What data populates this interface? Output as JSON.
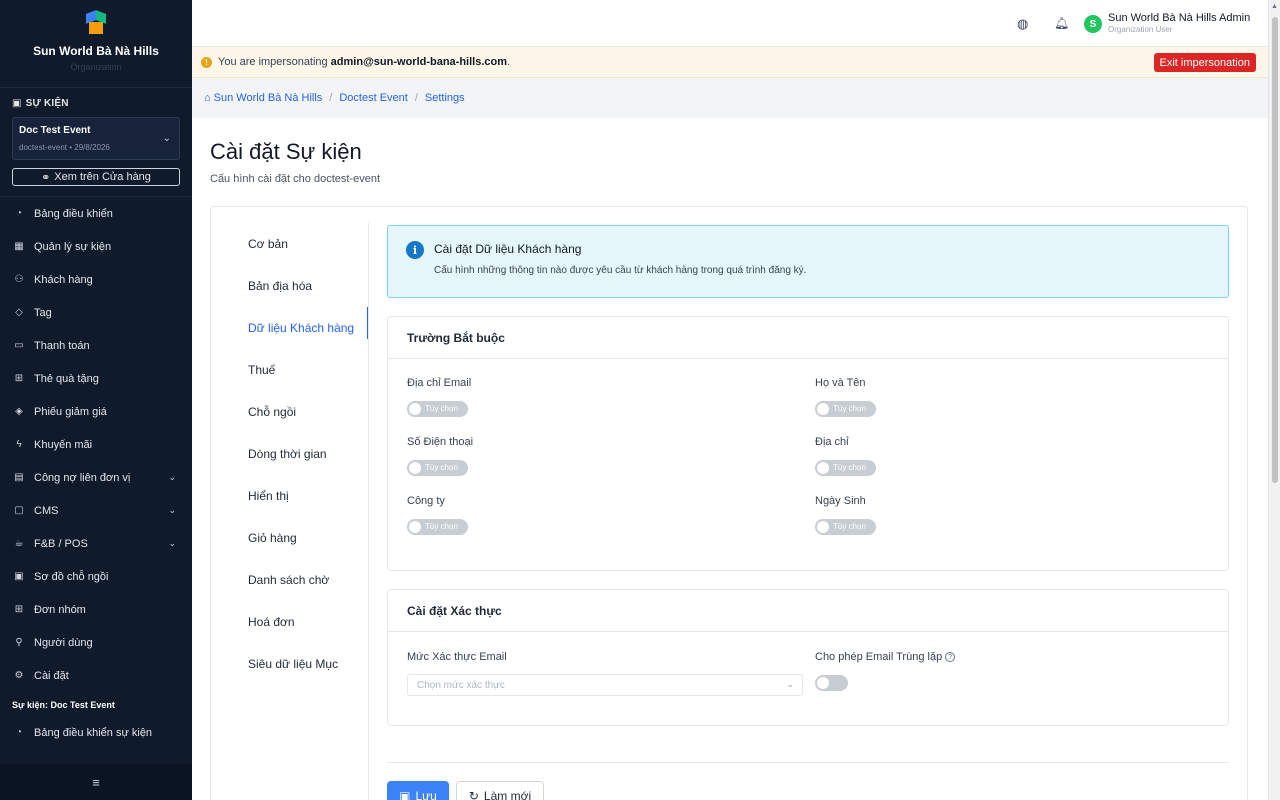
{
  "sidebar": {
    "brand_name": "Sun World Bà Nà Hills",
    "brand_sub": "Organization",
    "section_title": "SỰ KIỆN",
    "event_name": "Doc Test Event",
    "event_meta": "doctest-event • 29/8/2026",
    "store_button": "Xem trên Cửa hàng",
    "items": [
      {
        "label": "Bảng điều khiển",
        "icon": "dashboard-icon"
      },
      {
        "label": "Quản lý sự kiện",
        "icon": "calendar-icon"
      },
      {
        "label": "Khách hàng",
        "icon": "users-icon"
      },
      {
        "label": "Tag",
        "icon": "tag-icon"
      },
      {
        "label": "Thanh toán",
        "icon": "payment-icon"
      },
      {
        "label": "Thẻ quà tặng",
        "icon": "gift-icon"
      },
      {
        "label": "Phiếu giảm giá",
        "icon": "coupon-icon"
      },
      {
        "label": "Khuyến mãi",
        "icon": "promotion-icon"
      },
      {
        "label": "Công nợ liên đơn vị",
        "icon": "debt-icon"
      },
      {
        "label": "CMS",
        "icon": "cms-icon"
      },
      {
        "label": "F&B / POS",
        "icon": "coffee-icon"
      },
      {
        "label": "Sơ đồ chỗ ngồi",
        "icon": "seat-map-icon"
      },
      {
        "label": "Đơn nhóm",
        "icon": "group-order-icon"
      },
      {
        "label": "Người dùng",
        "icon": "user-icon"
      },
      {
        "label": "Cài đặt",
        "icon": "gear-icon"
      }
    ],
    "group_title": "Sự kiện: Doc Test Event",
    "event_dashboard": "Bảng điều khiển sự kiện"
  },
  "topbar": {
    "user_name": "Sun World Bà Nà Hills Admin",
    "user_role": "Organization User",
    "avatar_letter": "S"
  },
  "impersonation": {
    "prefix": "You are impersonating",
    "email": "admin@sun-world-bana-hills.com",
    "suffix": ".",
    "exit_label": "Exit impersonation"
  },
  "breadcrumb": [
    "Sun World Bà Nà Hills",
    "Doctest Event",
    "Settings"
  ],
  "page": {
    "title": "Cài đặt Sự kiện",
    "subtitle": "Cấu hình cài đặt cho doctest-event"
  },
  "tabs": [
    "Cơ bản",
    "Bản địa hóa",
    "Dữ liệu Khách hàng",
    "Thuế",
    "Chỗ ngồi",
    "Dòng thời gian",
    "Hiển thị",
    "Giỏ hàng",
    "Danh sách chờ",
    "Hoá đơn",
    "Siêu dữ liệu Mục"
  ],
  "info": {
    "title": "Cài đặt Dữ liệu Khách hàng",
    "description": "Cấu hình những thông tin nào được yêu cầu từ khách hàng trong quá trình đăng ký."
  },
  "required_fields": {
    "title": "Trường Bắt buộc",
    "toggle_text": "Tùy chọn",
    "fields": [
      "Địa chỉ Email",
      "Họ và Tên",
      "Số Điện thoại",
      "Địa chỉ",
      "Công ty",
      "Ngày Sinh"
    ]
  },
  "verification": {
    "title": "Cài đặt Xác thực",
    "email_level_label": "Mức Xác thực Email",
    "email_level_placeholder": "Chọn mức xác thực",
    "duplicate_label": "Cho phép Email Trùng lặp"
  },
  "actions": {
    "save": "Lưu",
    "reset": "Làm mới"
  }
}
